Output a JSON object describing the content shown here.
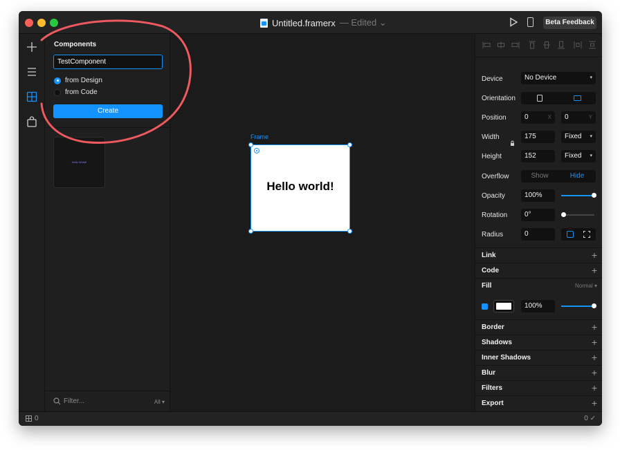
{
  "titlebar": {
    "title": "Untitled.framerx",
    "edited": "— Edited ⌄",
    "beta_label": "Beta Feedback"
  },
  "components": {
    "title": "Components",
    "name_value": "TestComponent",
    "option_design": "from Design",
    "option_code": "from Code",
    "create_label": "Create",
    "thumbnail_text": "Hello World!",
    "filter_placeholder": "Filter...",
    "filter_scope": "All ▾"
  },
  "canvas": {
    "frame_label": "Frame",
    "frame_text": "Hello world!"
  },
  "properties": {
    "device_label": "Device",
    "device_value": "No Device",
    "orientation_label": "Orientation",
    "position_label": "Position",
    "position_x": "0",
    "position_x_suffix": "X",
    "position_y": "0",
    "position_y_suffix": "Y",
    "width_label": "Width",
    "width_value": "175",
    "width_mode": "Fixed",
    "height_label": "Height",
    "height_value": "152",
    "height_mode": "Fixed",
    "overflow_label": "Overflow",
    "overflow_show": "Show",
    "overflow_hide": "Hide",
    "opacity_label": "Opacity",
    "opacity_value": "100%",
    "rotation_label": "Rotation",
    "rotation_value": "0°",
    "radius_label": "Radius",
    "radius_value": "0",
    "fill_opacity": "100%",
    "fill_blend": "Normal ▾",
    "fill_color": "#ffffff",
    "accent_color": "#1493ff",
    "sections": {
      "link": "Link",
      "code": "Code",
      "fill": "Fill",
      "border": "Border",
      "shadows": "Shadows",
      "inner_shadows": "Inner Shadows",
      "blur": "Blur",
      "filters": "Filters",
      "export": "Export"
    }
  },
  "statusbar": {
    "left_count": "0",
    "right_status": "0 ✓"
  }
}
